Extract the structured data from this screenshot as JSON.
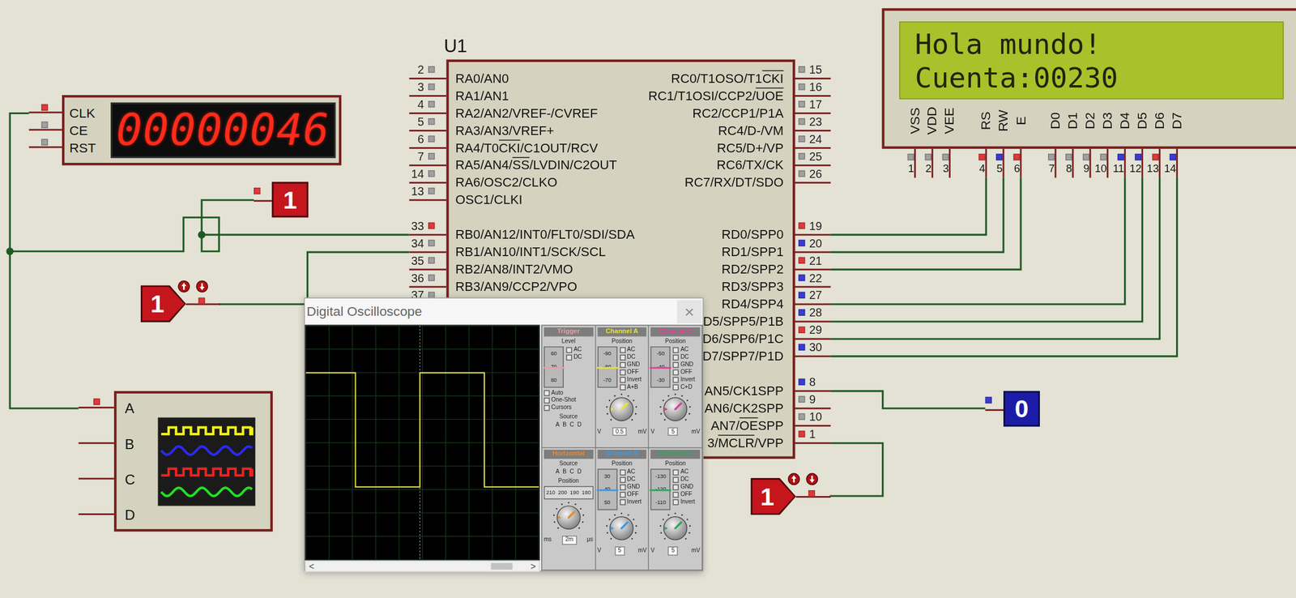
{
  "counter": {
    "pins": [
      {
        "label": "CLK",
        "state": "high"
      },
      {
        "label": "CE",
        "state": "float"
      },
      {
        "label": "RST",
        "state": "float"
      }
    ],
    "display": "00000046"
  },
  "chip": {
    "name": "U1",
    "left_groups": [
      [
        {
          "number": "2",
          "label": "RA0/AN0",
          "state": "float"
        },
        {
          "number": "3",
          "label": "RA1/AN1",
          "state": "float"
        },
        {
          "number": "4",
          "label": "RA2/AN2/VREF-/CVREF",
          "state": "float"
        },
        {
          "number": "5",
          "label": "RA3/AN3/VREF+",
          "state": "float"
        },
        {
          "number": "6",
          "label": "RA4/T0CKI/C1OUT/RCV",
          "bar": "CKI",
          "state": "float"
        },
        {
          "number": "7",
          "label": "RA5/AN4/SS/LVDIN/C2OUT",
          "bar": "SS",
          "state": "float"
        },
        {
          "number": "14",
          "label": "RA6/OSC2/CLKO",
          "state": "float"
        },
        {
          "number": "13",
          "label": "OSC1/CLKI",
          "state": "float"
        }
      ],
      [
        {
          "number": "33",
          "label": "RB0/AN12/INT0/FLT0/SDI/SDA",
          "state": "high"
        },
        {
          "number": "34",
          "label": "RB1/AN10/INT1/SCK/SCL",
          "state": "float"
        },
        {
          "number": "35",
          "label": "RB2/AN8/INT2/VMO",
          "state": "float"
        },
        {
          "number": "36",
          "label": "RB3/AN9/CCP2/VPO",
          "state": "float"
        },
        {
          "number": "37",
          "label": "",
          "state": "float"
        }
      ]
    ],
    "right_groups": [
      [
        {
          "number": "15",
          "label": "RC0/T1OSO/T1CKI",
          "bar": "CKI",
          "state": "float"
        },
        {
          "number": "16",
          "label": "RC1/T1OSI/CCP2/UOE",
          "bar": "UOE",
          "state": "float"
        },
        {
          "number": "17",
          "label": "RC2/CCP1/P1A",
          "state": "float"
        },
        {
          "number": "23",
          "label": "RC4/D-/VM",
          "state": "float"
        },
        {
          "number": "24",
          "label": "RC5/D+/VP",
          "state": "float"
        },
        {
          "number": "25",
          "label": "RC6/TX/CK",
          "state": "float"
        },
        {
          "number": "26",
          "label": "RC7/RX/DT/SDO",
          "state": "float"
        }
      ],
      [
        {
          "number": "19",
          "label": "RD0/SPP0",
          "state": "high"
        },
        {
          "number": "20",
          "label": "RD1/SPP1",
          "state": "low"
        },
        {
          "number": "21",
          "label": "RD2/SPP2",
          "state": "high"
        },
        {
          "number": "22",
          "label": "RD3/SPP3",
          "state": "low"
        },
        {
          "number": "27",
          "label": "RD4/SPP4",
          "state": "low"
        },
        {
          "number": "28",
          "label": "D5/SPP5/P1B",
          "state": "low"
        },
        {
          "number": "29",
          "label": "D6/SPP6/P1C",
          "state": "high"
        },
        {
          "number": "30",
          "label": "D7/SPP7/P1D",
          "state": "low"
        }
      ],
      [
        {
          "number": "8",
          "label": "AN5/CK1SPP",
          "state": "low"
        },
        {
          "number": "9",
          "label": "AN6/CK2SPP",
          "state": "float"
        },
        {
          "number": "10",
          "label": "AN7/OESPP",
          "bar": "OE",
          "state": "float"
        },
        {
          "number": "1",
          "label": "3/MCLR/VPP",
          "bar": "MCLR",
          "state": "high"
        }
      ]
    ]
  },
  "logic_probes": [
    {
      "value": "1",
      "state": "high"
    },
    {
      "value": "0",
      "state": "low"
    }
  ],
  "logic_states": [
    {
      "value": "1",
      "state": "high"
    },
    {
      "value": "1",
      "state": "high"
    }
  ],
  "scope_part": {
    "pins": [
      {
        "label": "A",
        "state": "high"
      },
      {
        "label": "B",
        "state": "off"
      },
      {
        "label": "C",
        "state": "off"
      },
      {
        "label": "D",
        "state": "off"
      }
    ]
  },
  "lcd": {
    "lines": [
      "Hola mundo!",
      "Cuenta:00230"
    ],
    "pins": [
      {
        "number": "1",
        "label": "VSS",
        "state": "float"
      },
      {
        "number": "2",
        "label": "VDD",
        "state": "float"
      },
      {
        "number": "3",
        "label": "VEE",
        "state": "float"
      },
      {
        "number": "4",
        "label": "RS",
        "state": "high"
      },
      {
        "number": "5",
        "label": "RW",
        "state": "low"
      },
      {
        "number": "6",
        "label": "E",
        "state": "high"
      },
      {
        "number": "7",
        "label": "D0",
        "state": "float"
      },
      {
        "number": "8",
        "label": "D1",
        "state": "float"
      },
      {
        "number": "9",
        "label": "D2",
        "state": "float"
      },
      {
        "number": "10",
        "label": "D3",
        "state": "float"
      },
      {
        "number": "11",
        "label": "D4",
        "state": "low"
      },
      {
        "number": "12",
        "label": "D5",
        "state": "low"
      },
      {
        "number": "13",
        "label": "D6",
        "state": "high"
      },
      {
        "number": "14",
        "label": "D7",
        "state": "low"
      }
    ]
  },
  "scope": {
    "title": "Digital Oscilloscope",
    "close": "×",
    "trace": {
      "channel": "A",
      "color": "#dcdc4a",
      "samples": [
        1,
        1,
        1,
        1,
        1,
        1,
        1,
        1,
        1,
        1,
        0,
        0,
        0,
        0,
        0,
        0,
        0,
        0,
        0,
        0,
        0,
        0,
        0,
        1,
        1,
        1,
        1,
        1,
        1,
        1,
        1,
        1,
        1,
        1,
        1,
        1,
        0,
        0,
        0,
        0,
        0,
        0,
        0,
        0,
        0,
        0,
        0
      ]
    },
    "scroll": {
      "left": "<",
      "right": ">"
    },
    "panels": [
      {
        "kind": "trigger",
        "title": "Trigger",
        "color": "#e6a0a8",
        "label": "Level",
        "ticks": [
          "60",
          "70",
          "80"
        ],
        "coupling": [
          "AC",
          "DC"
        ],
        "modes": [
          "Auto",
          "One-Shot",
          "Cursors"
        ],
        "source_label": "Source",
        "sources": [
          "A",
          "B",
          "C",
          "D"
        ]
      },
      {
        "kind": "channel",
        "title": "Channel A",
        "color": "#e8e23a",
        "label": "Position",
        "ticks": [
          "-90",
          "-80",
          "-70"
        ],
        "coupling": [
          "AC",
          "DC",
          "GND",
          "OFF"
        ],
        "options": [
          "Invert",
          "A+B"
        ],
        "unit_top": "V",
        "value": "0.5",
        "unit_bottom": "mV"
      },
      {
        "kind": "channel",
        "title": "Channel C",
        "color": "#e0409a",
        "label": "Position",
        "ticks": [
          "-50",
          "-40",
          "-30"
        ],
        "coupling": [
          "AC",
          "DC",
          "GND",
          "OFF"
        ],
        "options": [
          "Invert",
          "C+D"
        ],
        "unit_top": "V",
        "value": "5",
        "unit_bottom": "mV"
      },
      {
        "kind": "horizontal",
        "title": "Horizontal",
        "color": "#e88a2a",
        "label": "Source",
        "sources": [
          "A",
          "B",
          "C",
          "D"
        ],
        "sub": "Position",
        "ticks": [
          "210",
          "200",
          "190",
          "180"
        ],
        "unit_top": "ms",
        "value": "2m",
        "unit_bottom": "μs"
      },
      {
        "kind": "channel",
        "title": "Channel B",
        "color": "#3a9ae8",
        "label": "Position",
        "ticks": [
          "30",
          "40",
          "50"
        ],
        "coupling": [
          "AC",
          "DC",
          "GND",
          "OFF"
        ],
        "options": [
          "Invert"
        ],
        "unit_top": "V",
        "value": "5",
        "unit_bottom": "mV"
      },
      {
        "kind": "channel",
        "title": "Channel D",
        "color": "#2aa85a",
        "label": "Position",
        "ticks": [
          "-130",
          "-120",
          "-110"
        ],
        "coupling": [
          "AC",
          "DC",
          "GND",
          "OFF"
        ],
        "options": [
          "Invert"
        ],
        "unit_top": "V",
        "value": "5",
        "unit_bottom": "mV"
      }
    ]
  }
}
